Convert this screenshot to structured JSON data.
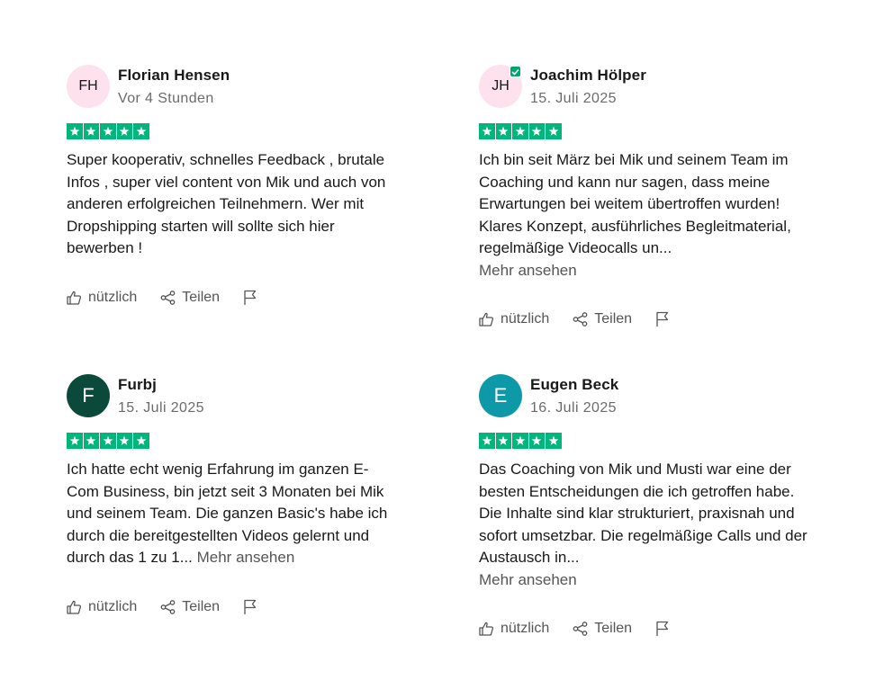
{
  "reviews": [
    {
      "initials": "FH",
      "name": "Florian Hensen",
      "date": "Vor 4 Stunden",
      "rating": 5,
      "text": "Super kooperativ, schnelles Feedback , brutale Infos , super viel content von Mik und auch von anderen erfolgreichen Teilnehmern. Wer mit Dropshipping starten will sollte sich hier bewerben !",
      "more": "",
      "avatar_bg": "#fde1ec",
      "avatar_fg": "#191919",
      "verified": false
    },
    {
      "initials": "JH",
      "name": "Joachim Hölper",
      "date": "15. Juli 2025",
      "rating": 5,
      "text": "Ich bin seit März bei Mik und seinem Team im Coaching und kann nur sagen, dass meine Erwartungen bei weitem übertroffen wurden! Klares Konzept, ausführliches Begleitmaterial, regelmäßige Videocalls un...",
      "more": "Mehr ansehen",
      "avatar_bg": "#fde1ec",
      "avatar_fg": "#191919",
      "verified": true
    },
    {
      "initials": "F",
      "name": "Furbj",
      "date": "15. Juli 2025",
      "rating": 5,
      "text": "Ich hatte echt wenig Erfahrung im ganzen E-Com Business, bin jetzt seit 3 Monaten bei Mik und seinem Team. Die ganzen Basic's habe ich durch die bereitgestellten Videos gelernt und durch das 1 zu 1...",
      "more": "Mehr ansehen",
      "avatar_bg": "#0b4a3a",
      "avatar_fg": "#ffffff",
      "verified": false
    },
    {
      "initials": "E",
      "name": "Eugen Beck",
      "date": "16. Juli 2025",
      "rating": 5,
      "text": "Das Coaching von Mik und Musti war eine der besten Entscheidungen die ich getroffen habe. Die Inhalte sind klar strukturiert, praxisnah und sofort umsetzbar. Die regelmäßige Calls und der Austausch in...",
      "more": "Mehr ansehen",
      "avatar_bg": "#0e99a8",
      "avatar_fg": "#ffffff",
      "verified": false
    }
  ],
  "labels": {
    "useful": "nützlich",
    "share": "Teilen"
  },
  "colors": {
    "star": "#00b67a",
    "verified": "#00a66e"
  }
}
